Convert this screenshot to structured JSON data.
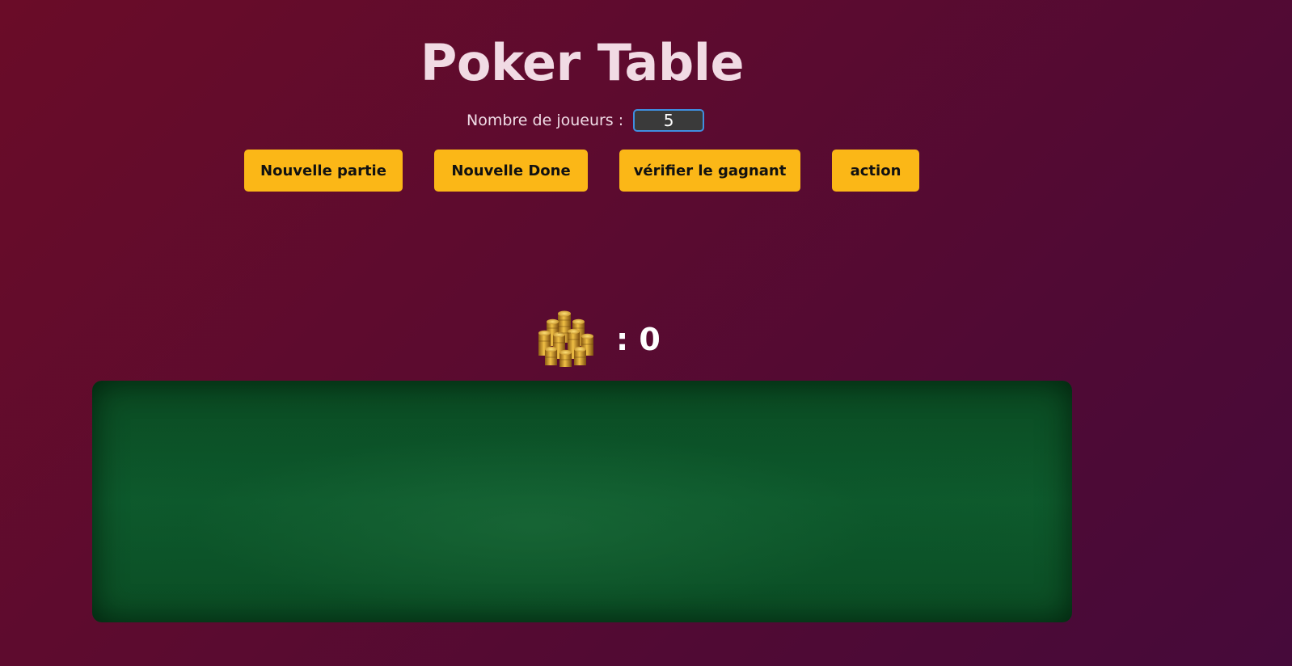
{
  "header": {
    "title": "Poker Table"
  },
  "players": {
    "label": "Nombre de joueurs :",
    "value": "5"
  },
  "buttons": {
    "new_game": "Nouvelle partie",
    "new_done": "Nouvelle Done",
    "check_winner": "vérifier le gagnant",
    "action": "action"
  },
  "pot": {
    "icon": "coin-stack-icon",
    "value": ": 0"
  },
  "colors": {
    "button": "#fbb717",
    "felt": "#0e5b2d",
    "background": "#5c0b2f",
    "input_border": "#3f8fe0"
  }
}
